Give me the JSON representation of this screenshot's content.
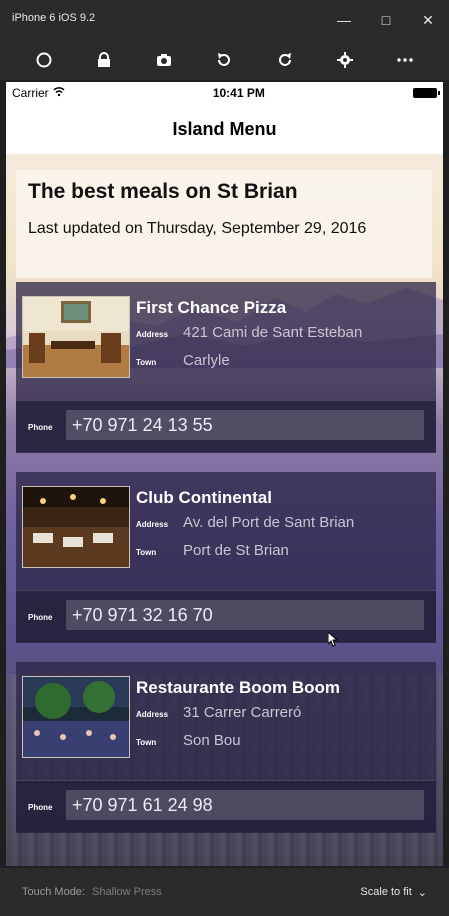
{
  "window": {
    "title": "iPhone 6 iOS 9.2",
    "controls": {
      "minimize_icon": "minimize-icon",
      "maximize_icon": "maximize-icon",
      "close_icon": "close-icon"
    }
  },
  "toolbar": {
    "buttons": [
      {
        "icon": "home-circle-icon"
      },
      {
        "icon": "lock-icon"
      },
      {
        "icon": "camera-icon"
      },
      {
        "icon": "rotate-left-icon"
      },
      {
        "icon": "rotate-right-icon"
      },
      {
        "icon": "gear-icon"
      },
      {
        "icon": "more-icon"
      }
    ]
  },
  "status_bar": {
    "carrier": "Carrier",
    "time": "10:41 PM"
  },
  "nav": {
    "title": "Island Menu"
  },
  "header": {
    "title": "The best meals on St Brian",
    "subtitle": "Last updated on Thursday, September 29, 2016"
  },
  "labels": {
    "address": "Address",
    "town": "Town",
    "phone": "Phone"
  },
  "restaurants": [
    {
      "name": "First Chance Pizza",
      "address": "421 Cami de Sant Esteban",
      "town": "Carlyle",
      "phone": "+70 971 24 13 55"
    },
    {
      "name": "Club Continental",
      "address": "Av. del Port de Sant Brian",
      "town": "Port de St Brian",
      "phone": "+70 971 32 16 70"
    },
    {
      "name": "Restaurante Boom Boom",
      "address": "31 Carrer Carreró",
      "town": "Son Bou",
      "phone": "+70 971 61 24 98"
    }
  ],
  "bottom_bar": {
    "touch_mode_label": "Touch Mode:",
    "touch_mode_value": "Shallow Press",
    "scale_label": "Scale to fit"
  }
}
